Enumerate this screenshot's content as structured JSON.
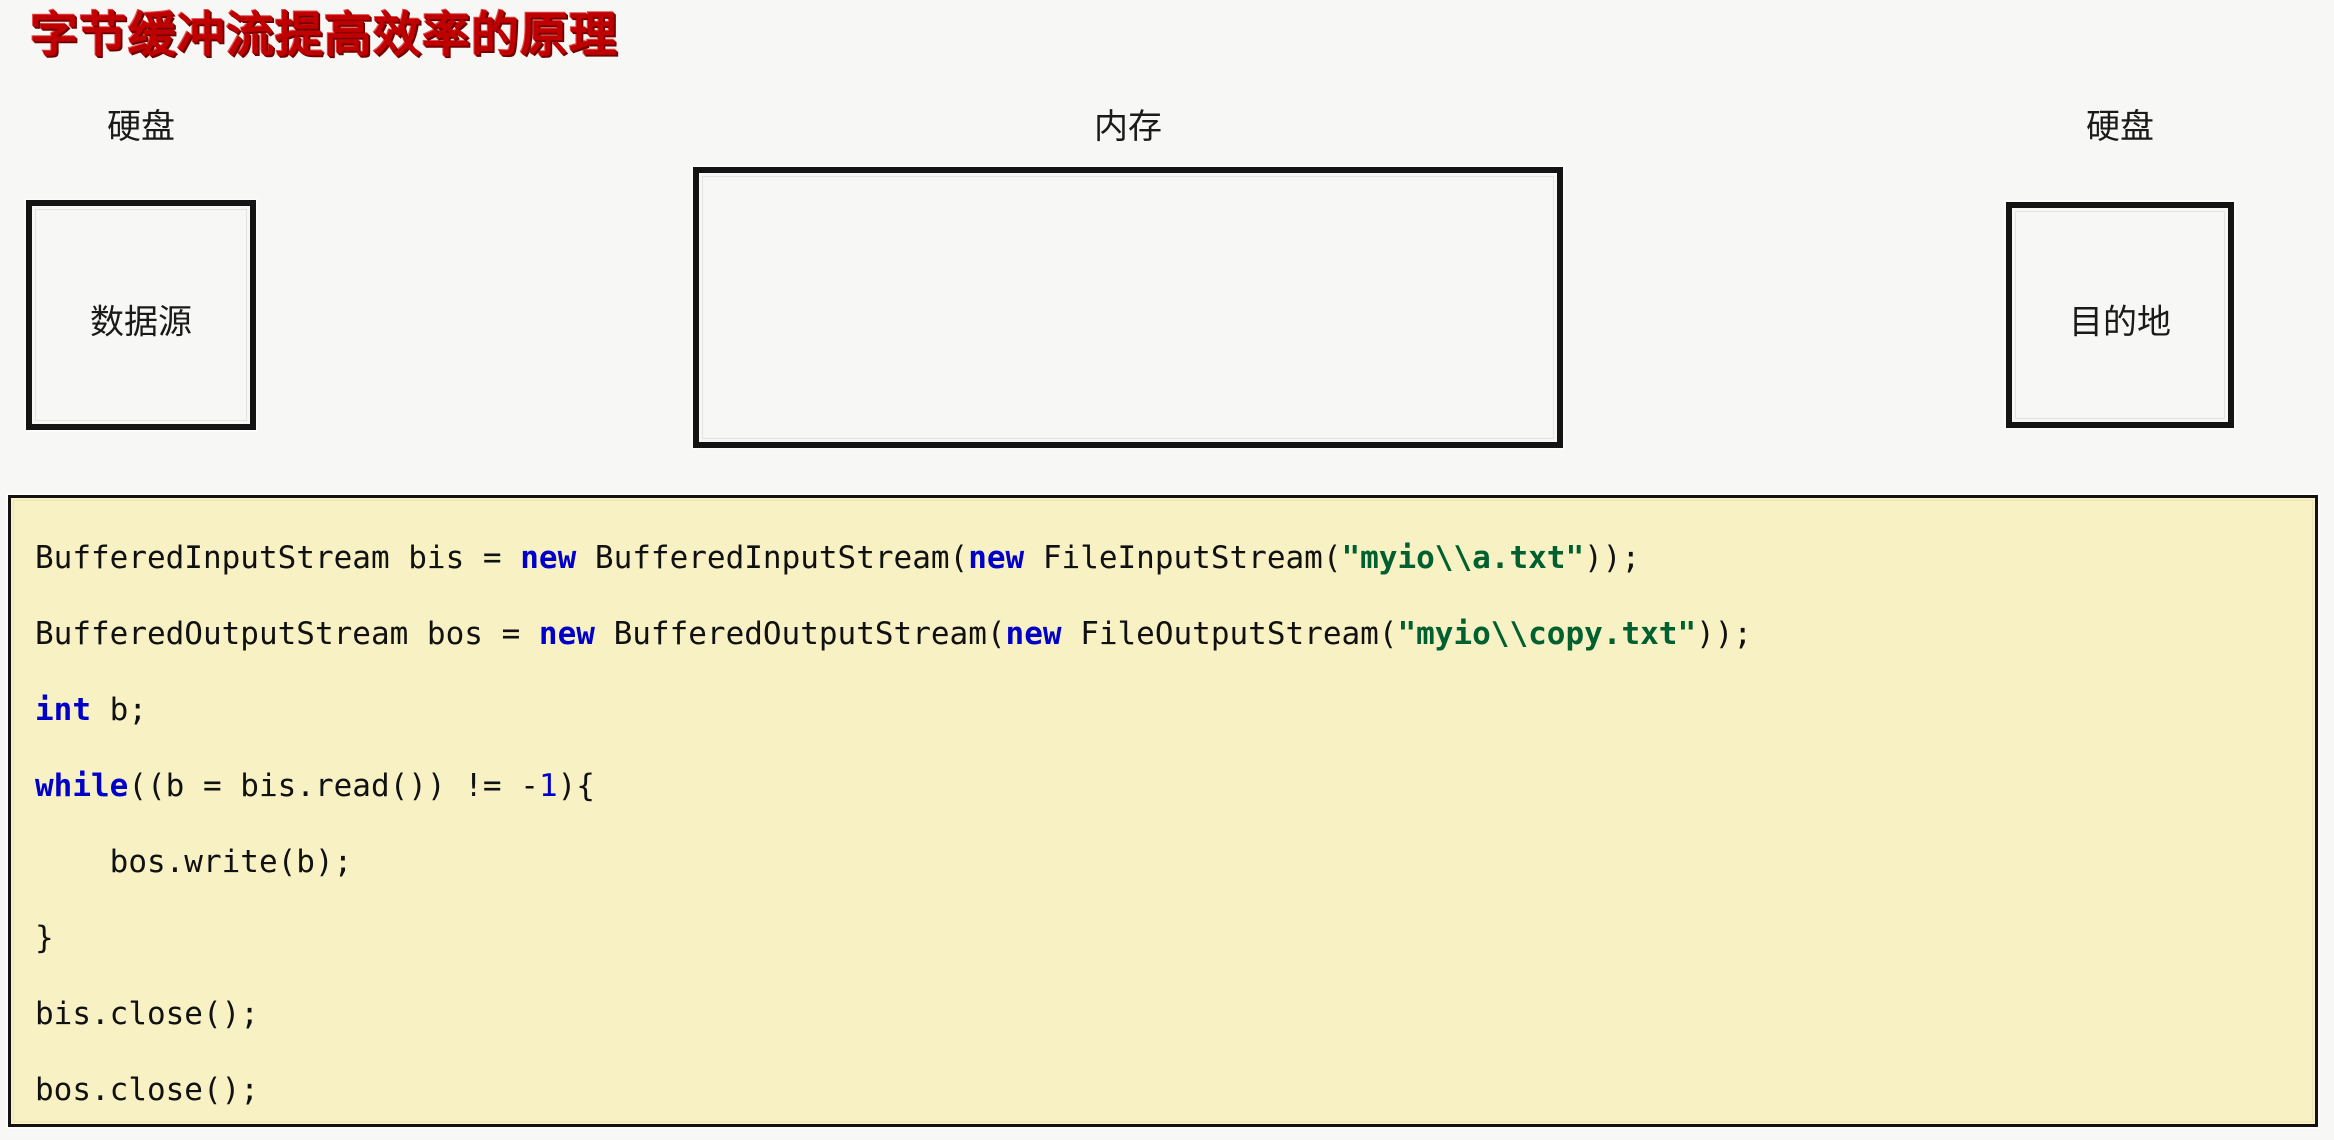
{
  "slide": {
    "title": "字节缓冲流提高效率的原理",
    "title_color": "#C00000",
    "background_color": "#F7F7F5"
  },
  "diagram": {
    "labels": {
      "disk_left": "硬盘",
      "memory": "内存",
      "disk_right": "硬盘"
    },
    "boxes": [
      {
        "name": "source",
        "text": "数据源"
      },
      {
        "name": "memory",
        "text": ""
      },
      {
        "name": "destination",
        "text": "目的地"
      }
    ]
  },
  "code": {
    "background_color": "#F7F1C4",
    "keyword_color": "#0000C8",
    "string_color": "#006030",
    "plain_color": "#111111",
    "lines": [
      {
        "index": 1,
        "text": "BufferedInputStream bis = new BufferedInputStream(new FileInputStream(\"myio\\\\a.txt\"));",
        "tokens": [
          {
            "t": "BufferedInputStream bis = ",
            "k": "plain"
          },
          {
            "t": "new",
            "k": "keyword"
          },
          {
            "t": " BufferedInputStream(",
            "k": "plain"
          },
          {
            "t": "new",
            "k": "keyword"
          },
          {
            "t": " FileInputStream(",
            "k": "plain"
          },
          {
            "t": "\"myio\\\\a.txt\"",
            "k": "string"
          },
          {
            "t": "));",
            "k": "plain"
          }
        ]
      },
      {
        "index": 2,
        "text": "BufferedOutputStream bos = new BufferedOutputStream(new FileOutputStream(\"myio\\\\copy.txt\"));",
        "tokens": [
          {
            "t": "BufferedOutputStream bos = ",
            "k": "plain"
          },
          {
            "t": "new",
            "k": "keyword"
          },
          {
            "t": " BufferedOutputStream(",
            "k": "plain"
          },
          {
            "t": "new",
            "k": "keyword"
          },
          {
            "t": " FileOutputStream(",
            "k": "plain"
          },
          {
            "t": "\"myio\\\\copy.txt\"",
            "k": "string"
          },
          {
            "t": "));",
            "k": "plain"
          }
        ]
      },
      {
        "index": 3,
        "text": "int b;",
        "tokens": [
          {
            "t": "int",
            "k": "keyword"
          },
          {
            "t": " b;",
            "k": "plain"
          }
        ]
      },
      {
        "index": 4,
        "text": "while((b = bis.read()) != -1){",
        "tokens": [
          {
            "t": "while",
            "k": "keyword"
          },
          {
            "t": "((b = bis.read()) != -",
            "k": "plain"
          },
          {
            "t": "1",
            "k": "number"
          },
          {
            "t": "){",
            "k": "plain"
          }
        ]
      },
      {
        "index": 5,
        "text": "    bos.write(b);",
        "tokens": [
          {
            "t": "    bos.write(b);",
            "k": "plain"
          }
        ]
      },
      {
        "index": 6,
        "text": "}",
        "tokens": [
          {
            "t": "}",
            "k": "plain"
          }
        ]
      },
      {
        "index": 7,
        "text": "bis.close();",
        "tokens": [
          {
            "t": "bis.close();",
            "k": "plain"
          }
        ]
      },
      {
        "index": 8,
        "text": "bos.close();",
        "tokens": [
          {
            "t": "bos.close();",
            "k": "plain"
          }
        ]
      }
    ]
  }
}
